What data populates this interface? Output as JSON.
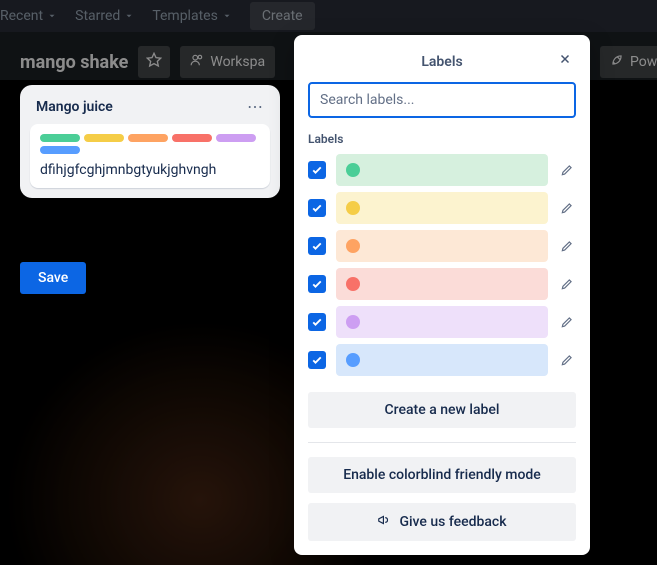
{
  "topnav": {
    "recent": "Recent",
    "starred": "Starred",
    "templates": "Templates",
    "create": "Create"
  },
  "board": {
    "title": "mango shake",
    "workspace_btn": "Workspa",
    "power_btn": "Power"
  },
  "list": {
    "title": "Mango juice",
    "card_text": "dfihjgfcghjmnbgtyukjghvngh"
  },
  "card_labels": [
    {
      "color": "#4bce97"
    },
    {
      "color": "#f5cd47"
    },
    {
      "color": "#fea362"
    },
    {
      "color": "#f87168"
    },
    {
      "color": "#cd9ef2"
    },
    {
      "color": "#579dff"
    }
  ],
  "save_label": "Save",
  "popover": {
    "title": "Labels",
    "search_placeholder": "Search labels...",
    "section": "Labels",
    "labels": [
      {
        "bar": "#d6f0de",
        "dot": "#4bce97",
        "checked": true
      },
      {
        "bar": "#fcf3cf",
        "dot": "#f5cd47",
        "checked": true
      },
      {
        "bar": "#fde8d6",
        "dot": "#fea362",
        "checked": true
      },
      {
        "bar": "#fbdcd8",
        "dot": "#f87168",
        "checked": true
      },
      {
        "bar": "#eee0fa",
        "dot": "#cd9ef2",
        "checked": true
      },
      {
        "bar": "#d7e7fb",
        "dot": "#579dff",
        "checked": true
      }
    ],
    "create_label": "Create a new label",
    "colorblind_label": "Enable colorblind friendly mode",
    "feedback_label": "Give us feedback"
  }
}
